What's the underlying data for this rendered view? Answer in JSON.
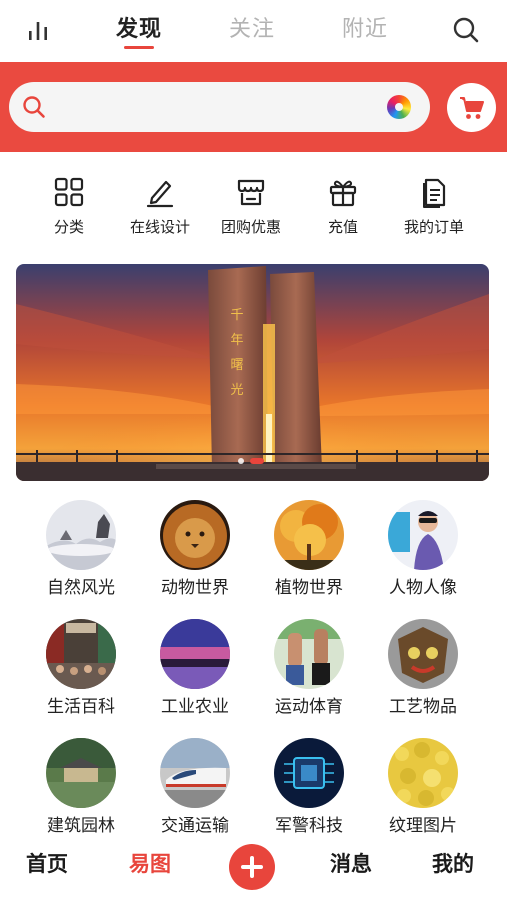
{
  "top_nav": {
    "tabs": [
      {
        "label": "发现",
        "active": true
      },
      {
        "label": "关注",
        "active": false
      },
      {
        "label": "附近",
        "active": false
      }
    ],
    "left_icon": "bar-chart-icon",
    "right_icon": "search-icon"
  },
  "search": {
    "placeholder": "",
    "value": "",
    "left_icon": "search-icon",
    "right_icon": "color-wheel-icon",
    "cart_icon": "shopping-cart-icon"
  },
  "quick_menu": [
    {
      "label": "分类",
      "icon": "grid-icon"
    },
    {
      "label": "在线设计",
      "icon": "pencil-icon"
    },
    {
      "label": "团购优惠",
      "icon": "storefront-icon"
    },
    {
      "label": "充值",
      "icon": "gift-icon"
    },
    {
      "label": "我的订单",
      "icon": "document-icon"
    }
  ],
  "banner": {
    "monument_text": "千年曙光",
    "dots": 2,
    "active_dot": 2
  },
  "categories": [
    {
      "label": "自然风光"
    },
    {
      "label": "动物世界"
    },
    {
      "label": "植物世界"
    },
    {
      "label": "人物人像"
    },
    {
      "label": "生活百科"
    },
    {
      "label": "工业农业"
    },
    {
      "label": "运动体育"
    },
    {
      "label": "工艺物品"
    },
    {
      "label": "建筑园林"
    },
    {
      "label": "交通运输"
    },
    {
      "label": "军警科技"
    },
    {
      "label": "纹理图片"
    }
  ],
  "bottom_nav": {
    "tabs": [
      {
        "label": "首页",
        "active": false
      },
      {
        "label": "易图",
        "active": true
      },
      {
        "label": "消息",
        "active": false
      },
      {
        "label": "我的",
        "active": false
      }
    ],
    "center_icon": "plus-icon"
  },
  "colors": {
    "accent": "#e8453c",
    "search_band": "#ea4a40"
  }
}
